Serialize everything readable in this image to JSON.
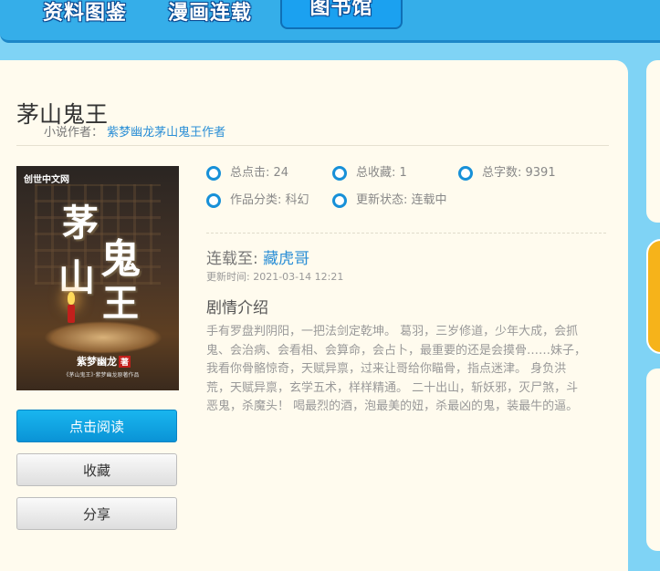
{
  "nav": {
    "tabs": [
      {
        "label": "资料图鉴"
      },
      {
        "label": "漫画连载"
      },
      {
        "label": "图书馆"
      }
    ]
  },
  "book": {
    "title": "茅山鬼王",
    "author_label": "小说作者：",
    "author_link": "紫梦幽龙茅山鬼王作者"
  },
  "cover": {
    "publisher": "创世中文网",
    "title_chars": [
      "茅",
      "鬼",
      "山",
      "王"
    ],
    "author": "紫梦幽龙",
    "stamp": "著",
    "note": "《茅山鬼王》·紫梦幽龙原著作品"
  },
  "stats": {
    "clicks": "总点击: 24",
    "favorites": "总收藏: 1",
    "words": "总字数: 9391",
    "category": "作品分类: 科幻",
    "status": "更新状态: 连载中"
  },
  "update": {
    "prefix": "连载至:",
    "chapter": "藏虎哥",
    "time": "更新时间: 2021-03-14 12:21"
  },
  "intro": {
    "heading": "剧情介绍",
    "text": "手有罗盘判阴阳，一把法剑定乾坤。 葛羽，三岁修道，少年大成，会抓鬼、会治病、会看相、会算命，会占卜，最重要的还是会摸骨……妹子，我看你骨骼惊奇，天赋异禀，过来让哥给你瞄骨，指点迷津。 身负洪荒，天赋异禀，玄学五术，样样精通。 二十出山，斩妖邪，灭尸煞，斗恶鬼，杀魔头！ 喝最烈的酒，泡最美的妞，杀最凶的鬼，装最牛的逼。"
  },
  "buttons": {
    "read": "点击阅读",
    "favorite": "收藏",
    "share": "分享"
  },
  "colors": {
    "accent": "#1790d8",
    "nav_bg": "#35aee9",
    "page_bg": "#7fd3f5",
    "card_bg": "#fffbee",
    "read_button": "#0a93d6"
  }
}
